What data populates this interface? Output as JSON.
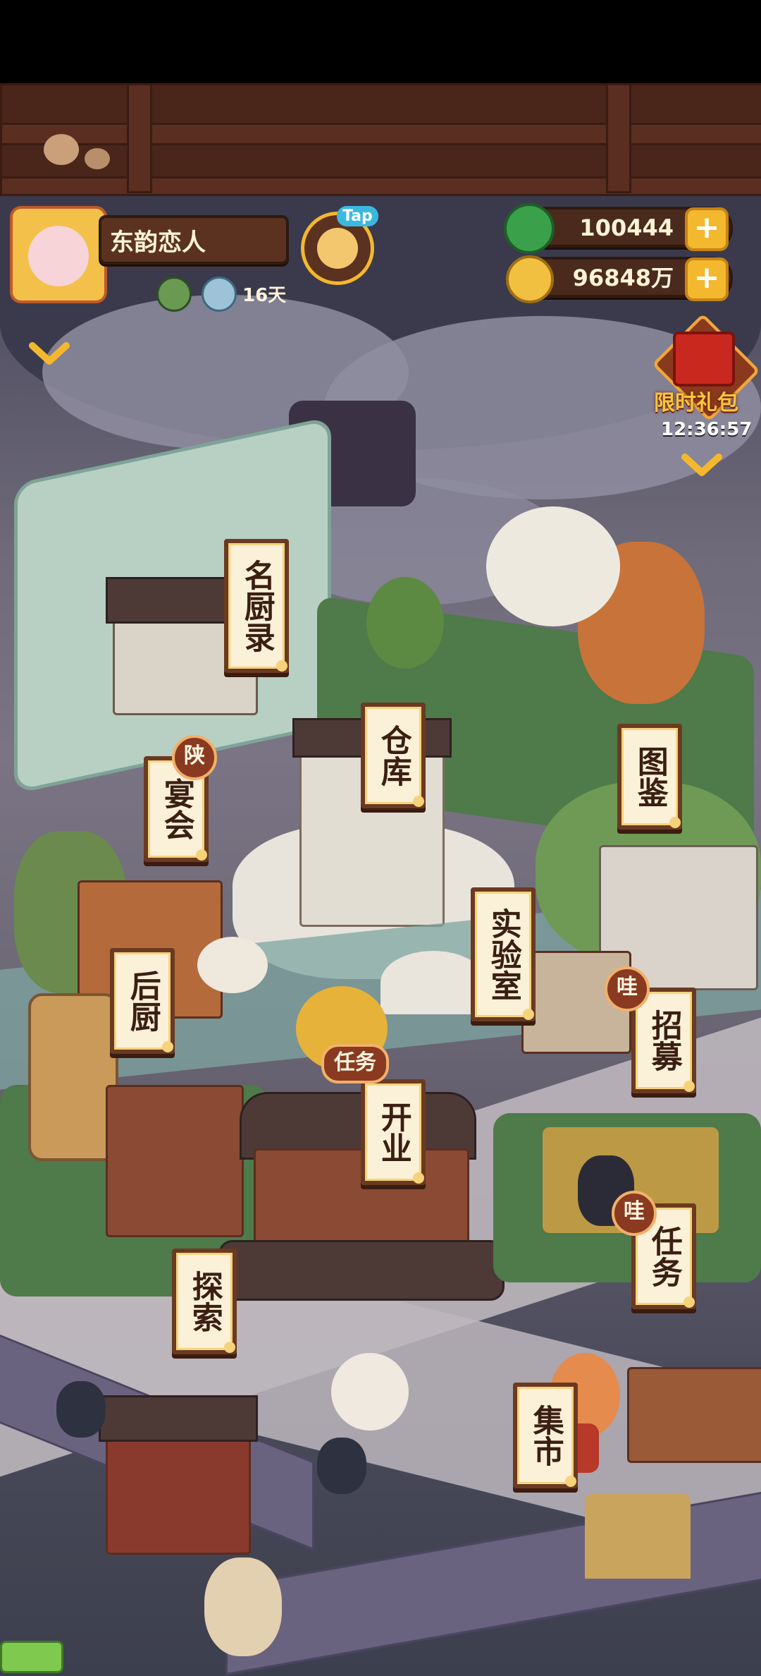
{
  "player": {
    "name": "东韵恋人",
    "days": "16天"
  },
  "tap_label": "Tap",
  "currency": {
    "jade": "100444",
    "coins": "96848万"
  },
  "gift": {
    "label": "限时礼包",
    "timer": "12:36:57"
  },
  "buildings": {
    "chef_book": "名厨录",
    "warehouse": "仓库",
    "banquet": "宴会",
    "banquet_badge": "陕",
    "catalog": "图鉴",
    "lab": "实验室",
    "kitchen": "后厨",
    "recruit": "招募",
    "recruit_badge": "哇",
    "open": "开业",
    "open_badge": "任务",
    "explore": "探索",
    "tasks": "任务",
    "tasks_badge": "哇",
    "market": "集市"
  },
  "colors": {
    "accent_gold": "#f4b82e",
    "wood_dark": "#4a2a1c",
    "sign_paper": "#fbf1d8"
  },
  "icons": {
    "jade": "green-jade-icon",
    "coin": "gold-coin-icon",
    "plus": "plus-icon",
    "chevron": "chevron-down-icon"
  }
}
